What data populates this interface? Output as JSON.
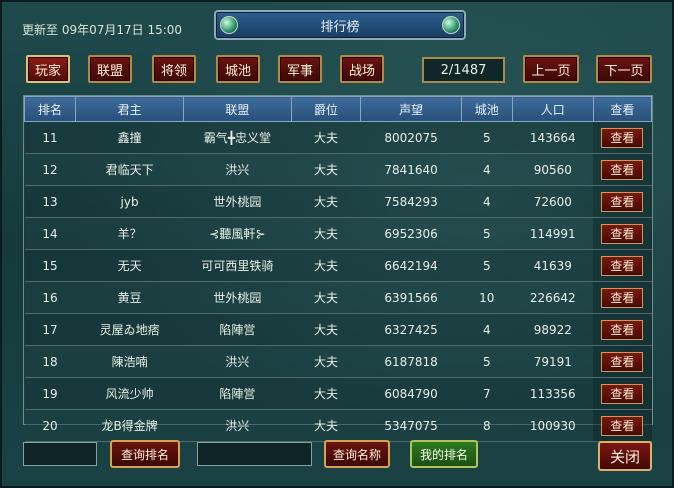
{
  "header": {
    "update_time": "更新至 09年07月17日 15:00",
    "title": "排行榜"
  },
  "categories": [
    "玩家",
    "联盟",
    "将领",
    "城池",
    "军事",
    "战场"
  ],
  "pagination": {
    "indicator": "2/1487",
    "prev_label": "上一页",
    "next_label": "下一页"
  },
  "table": {
    "columns": [
      "排名",
      "君主",
      "联盟",
      "爵位",
      "声望",
      "城池",
      "人口",
      "查看"
    ],
    "view_label": "查看",
    "rows": [
      {
        "rank": "11",
        "lord": "鑫撞",
        "alliance": "霸气╋忠义堂",
        "title": "大夫",
        "prestige": "8002075",
        "cities": "5",
        "population": "143664"
      },
      {
        "rank": "12",
        "lord": "君临天下",
        "alliance": "洪兴",
        "title": "大夫",
        "prestige": "7841640",
        "cities": "4",
        "population": "90560"
      },
      {
        "rank": "13",
        "lord": "jyb",
        "alliance": "世外桃园",
        "title": "大夫",
        "prestige": "7584293",
        "cities": "4",
        "population": "72600"
      },
      {
        "rank": "14",
        "lord": "羊？",
        "alliance": "⊰聽風軒⊱",
        "title": "大夫",
        "prestige": "6952306",
        "cities": "5",
        "population": "114991"
      },
      {
        "rank": "15",
        "lord": "无天",
        "alliance": "可可西里铁骑",
        "title": "大夫",
        "prestige": "6642194",
        "cities": "5",
        "population": "41639"
      },
      {
        "rank": "16",
        "lord": "黄豆",
        "alliance": "世外桃园",
        "title": "大夫",
        "prestige": "6391566",
        "cities": "10",
        "population": "226642"
      },
      {
        "rank": "17",
        "lord": "灵屋ゐ地痞",
        "alliance": "陷陣営",
        "title": "大夫",
        "prestige": "6327425",
        "cities": "4",
        "population": "98922"
      },
      {
        "rank": "18",
        "lord": "陳浩喃",
        "alliance": "洪兴",
        "title": "大夫",
        "prestige": "6187818",
        "cities": "5",
        "population": "79191"
      },
      {
        "rank": "19",
        "lord": "风流少帅",
        "alliance": "陷陣営",
        "title": "大夫",
        "prestige": "6084790",
        "cities": "7",
        "population": "113356"
      },
      {
        "rank": "20",
        "lord": "龙B得金牌",
        "alliance": "洪兴",
        "title": "大夫",
        "prestige": "5347075",
        "cities": "8",
        "population": "100930"
      }
    ]
  },
  "footer": {
    "query_rank_label": "查询排名",
    "query_name_label": "查询名称",
    "my_rank_label": "我的排名",
    "close_label": "关闭"
  }
}
